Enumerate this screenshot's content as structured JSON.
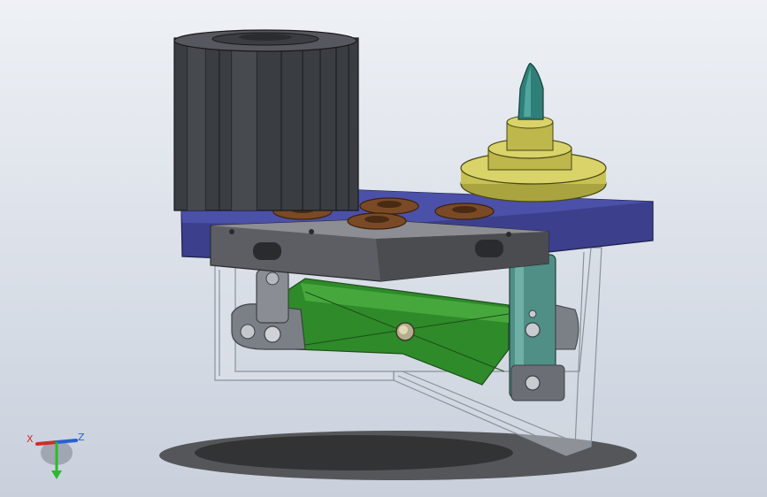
{
  "viewport": {
    "background_top": "#eef1f5",
    "background_bottom": "#c9d0dc"
  },
  "model": {
    "colors": {
      "cylinder": "#3a3d42",
      "base_plate": "#3b3f8c",
      "front_bracket": "#5c5e63",
      "spacer": "#7a4a26",
      "locator_pin": "#2f7f78",
      "pin_flange": "#c8c255",
      "linkage_arm": "#2f8a2a",
      "rod": "#4f8f86",
      "transparent_frame": "#b6bfca"
    },
    "parts": [
      "cylinder",
      "base-plate",
      "front-bracket",
      "spacer-washers",
      "locator-pin",
      "linkage-arm",
      "clevis-left",
      "rod-right",
      "transparent-frame",
      "ground-shadow"
    ]
  },
  "triad": {
    "x_label": "X",
    "z_label": "Z",
    "x_color": "#d42b2b",
    "z_color": "#2b5fd4",
    "y_color": "#2eb82e"
  }
}
